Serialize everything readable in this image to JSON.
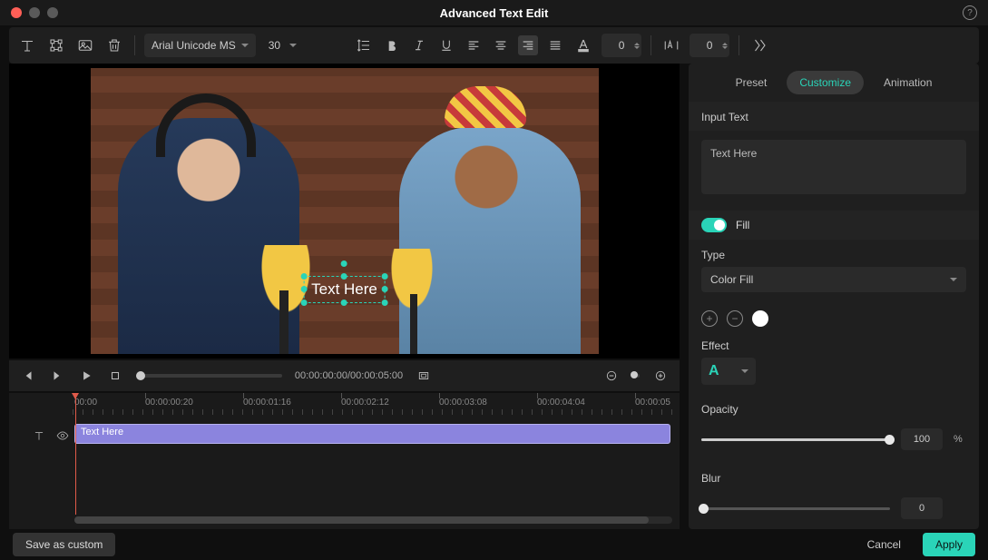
{
  "window": {
    "title": "Advanced Text Edit"
  },
  "toolbar": {
    "font": "Arial Unicode MS",
    "size": "30",
    "tracking": "0",
    "leading": "0"
  },
  "preview": {
    "overlay_text": "Text Here"
  },
  "transport": {
    "timecode": "00:00:00:00/00:00:05:00"
  },
  "timeline": {
    "marks": [
      "00:00",
      "00:00:00:20",
      "00:00:01:16",
      "00:00:02:12",
      "00:00:03:08",
      "00:00:04:04",
      "00:00:05"
    ],
    "clip_label": "Text Here"
  },
  "right": {
    "tabs": {
      "preset": "Preset",
      "customize": "Customize",
      "animation": "Animation"
    },
    "input_section": "Input Text",
    "input_value": "Text Here",
    "fill": "Fill",
    "type_label": "Type",
    "type_value": "Color Fill",
    "effect_label": "Effect",
    "opacity_label": "Opacity",
    "opacity_value": "100",
    "opacity_unit": "%",
    "blur_label": "Blur",
    "blur_value": "0"
  },
  "buttons": {
    "save_custom": "Save as custom",
    "cancel": "Cancel",
    "apply": "Apply"
  }
}
